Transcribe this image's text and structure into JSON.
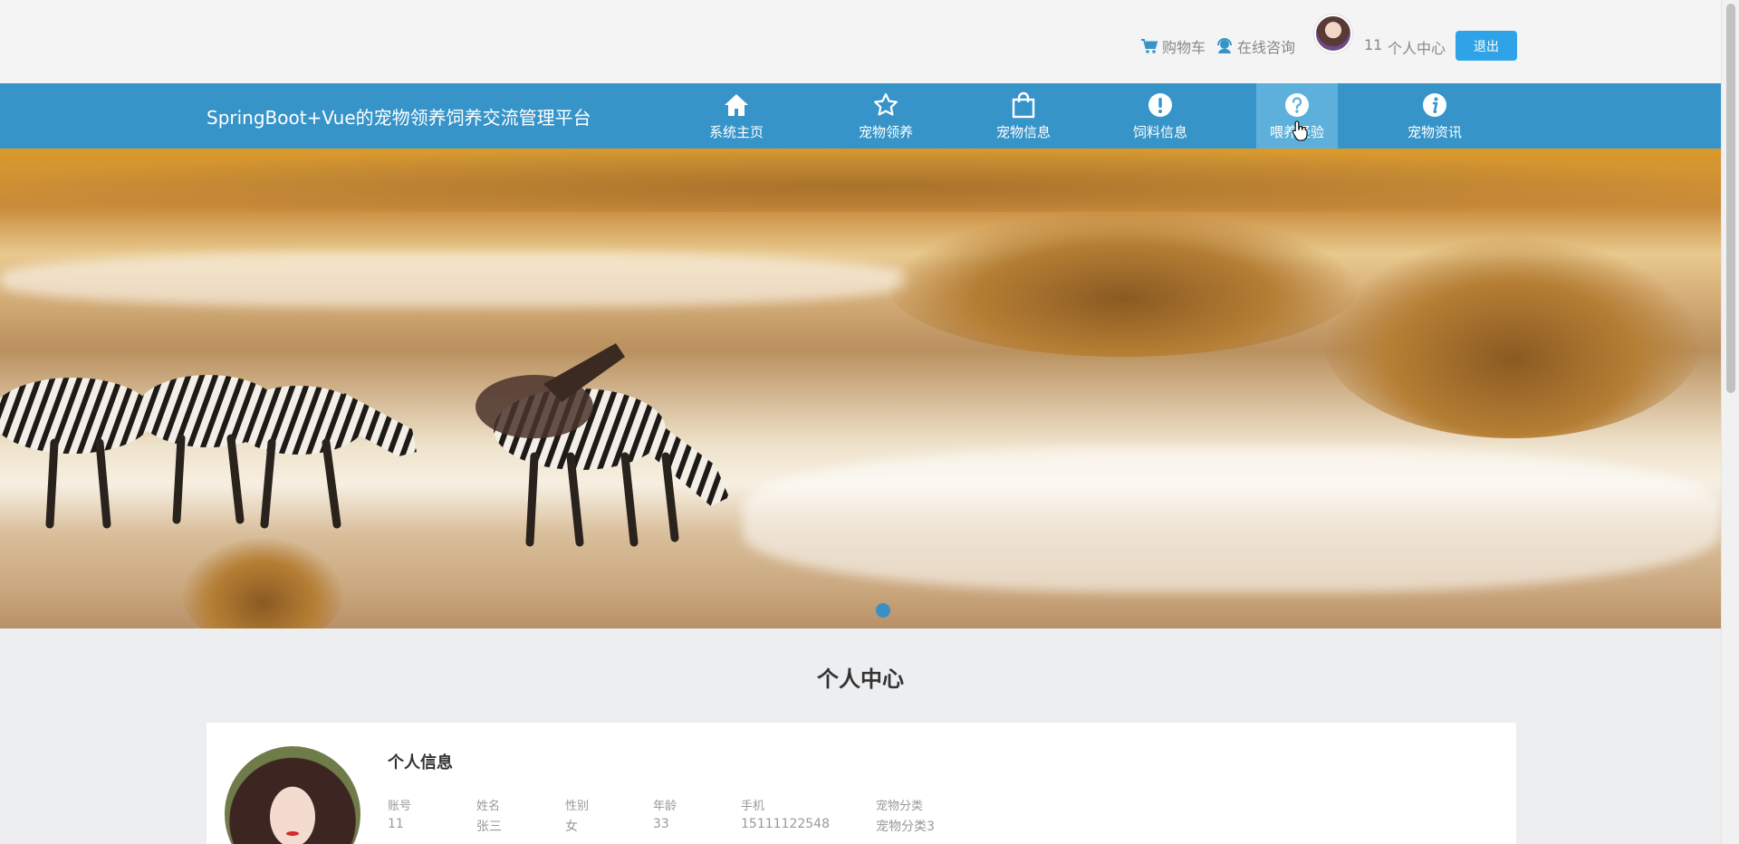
{
  "topbar": {
    "cart_label": "购物车",
    "consult_label": "在线咨询",
    "username": "11",
    "center_label": "个人中心",
    "logout_label": "退出"
  },
  "navbar": {
    "brand": "SpringBoot+Vue的宠物领养饲养交流管理平台",
    "items": [
      {
        "label": "系统主页",
        "icon": "home-icon"
      },
      {
        "label": "宠物领养",
        "icon": "star-icon"
      },
      {
        "label": "宠物信息",
        "icon": "shopping-bag-icon"
      },
      {
        "label": "饲料信息",
        "icon": "exclamation-circle-icon"
      },
      {
        "label": "喂养经验",
        "icon": "question-circle-icon"
      },
      {
        "label": "宠物资讯",
        "icon": "info-circle-icon"
      }
    ],
    "active_index": 4,
    "accent_color": "#3694c9"
  },
  "section": {
    "title": "个人中心"
  },
  "profile": {
    "heading": "个人信息",
    "fields": [
      {
        "label": "账号",
        "value": "11"
      },
      {
        "label": "姓名",
        "value": "张三"
      },
      {
        "label": "性别",
        "value": "女"
      },
      {
        "label": "年龄",
        "value": "33"
      },
      {
        "label": "手机",
        "value": "15111122548"
      },
      {
        "label": "宠物分类",
        "value": "宠物分类3"
      }
    ]
  }
}
